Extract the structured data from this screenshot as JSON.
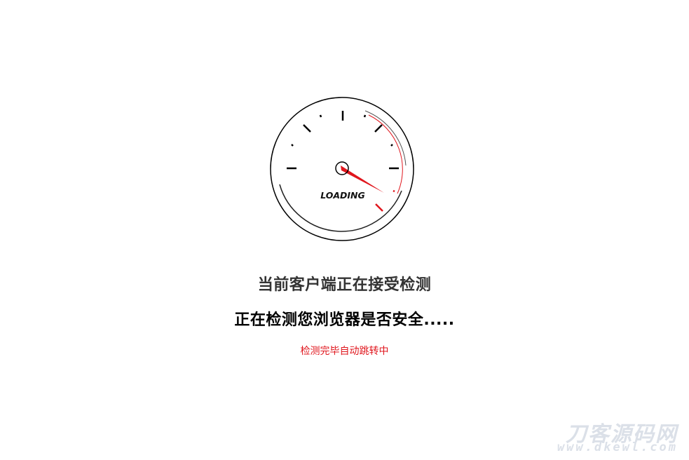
{
  "gauge": {
    "label": "LOADING",
    "needle_color": "#e0161d",
    "redline_color": "#e0161d"
  },
  "title": "当前客户端正在接受检测",
  "subtitle": "正在检测您浏览器是否安全.....",
  "note": "检测完毕自动跳转中",
  "watermark": {
    "main": "刀客源码网",
    "url": "www.dkewl.com"
  }
}
